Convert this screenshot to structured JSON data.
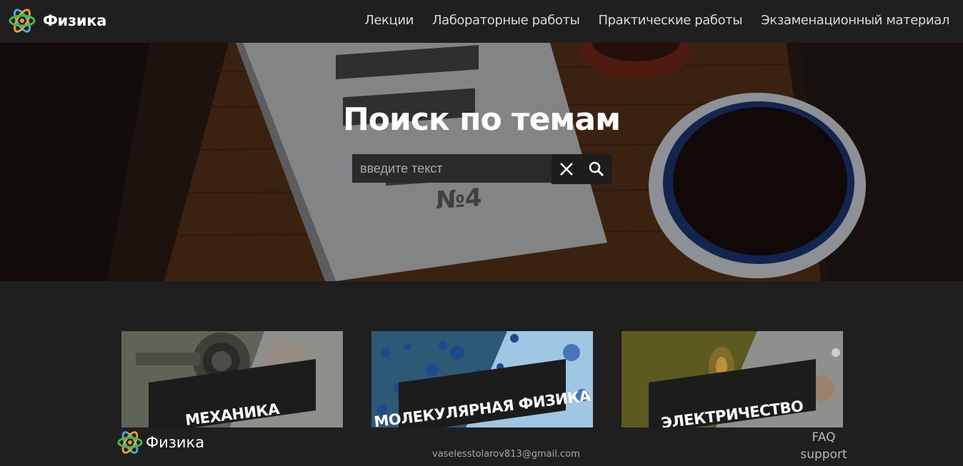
{
  "header": {
    "brand": "Физика",
    "nav": [
      "Лекции",
      "Лабораторные работы",
      "Практические работы",
      "Экзаменационный материал"
    ]
  },
  "hero": {
    "title": "Поиск по темам",
    "search_placeholder": "введите текст"
  },
  "cards": [
    "МЕХАНИКА",
    "МОЛЕКУЛЯРНАЯ ФИЗИКА",
    "ЭЛЕКТРИЧЕСТВО"
  ],
  "footer": {
    "brand": "Физика",
    "email": "vaselesstolarov813@gmail.com",
    "faq": "FAQ",
    "support": "support"
  },
  "colors": {
    "background": "#1f1f1f",
    "atom_orange": "#f0a020",
    "atom_blue": "#3ab0e0",
    "atom_green": "#4ab84a"
  }
}
